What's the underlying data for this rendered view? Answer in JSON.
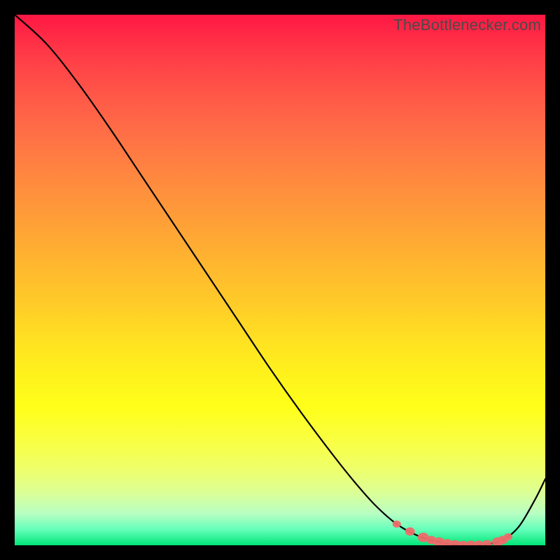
{
  "watermark": "TheBottlenecker.com",
  "chart_data": {
    "type": "line",
    "title": "",
    "xlabel": "",
    "ylabel": "",
    "xlim": [
      0,
      100
    ],
    "ylim": [
      0,
      100
    ],
    "series": [
      {
        "name": "curve",
        "x": [
          0,
          6,
          12,
          18,
          24,
          30,
          36,
          42,
          48,
          54,
          60,
          64,
          68,
          72,
          76,
          80,
          83,
          86,
          89,
          92,
          95,
          98,
          100
        ],
        "y": [
          100,
          94.5,
          87,
          78.5,
          69.5,
          60.5,
          51.5,
          42.5,
          33.5,
          25,
          17,
          12,
          7.5,
          4,
          1.8,
          0.6,
          0.1,
          0.0,
          0.2,
          1.0,
          3.5,
          8.5,
          12.5
        ]
      }
    ],
    "dots": {
      "name": "sweet-spot",
      "color": "#ef6a6a",
      "x": [
        72,
        74.5,
        77,
        78.5,
        80,
        81.5,
        83,
        84.5,
        86,
        87.5,
        89,
        91,
        92,
        93
      ],
      "y": [
        4.0,
        2.6,
        1.5,
        1.0,
        0.6,
        0.4,
        0.1,
        0.05,
        0.0,
        0.1,
        0.2,
        0.6,
        1.0,
        1.6
      ],
      "r": [
        6,
        7,
        8,
        7,
        8,
        7,
        8,
        7,
        8,
        7,
        7,
        8,
        7,
        6
      ]
    },
    "gradient_stops": [
      {
        "pos": 0.0,
        "color": "#ff1744"
      },
      {
        "pos": 0.5,
        "color": "#ffd027"
      },
      {
        "pos": 0.8,
        "color": "#f6ff4e"
      },
      {
        "pos": 1.0,
        "color": "#00e676"
      }
    ]
  }
}
